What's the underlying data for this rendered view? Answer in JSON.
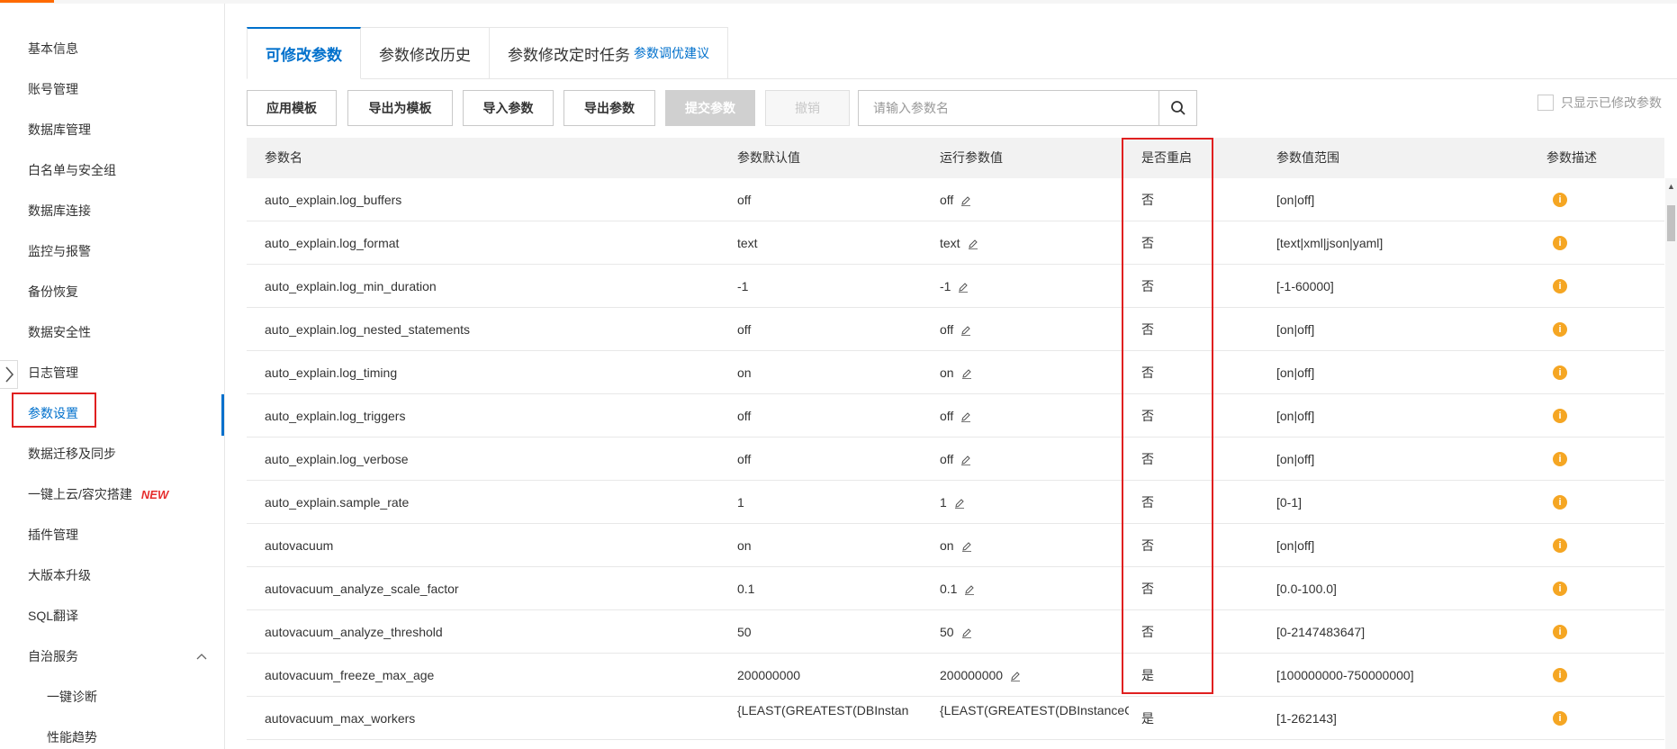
{
  "sidebar": {
    "items": [
      {
        "label": "基本信息"
      },
      {
        "label": "账号管理"
      },
      {
        "label": "数据库管理"
      },
      {
        "label": "白名单与安全组"
      },
      {
        "label": "数据库连接"
      },
      {
        "label": "监控与报警"
      },
      {
        "label": "备份恢复"
      },
      {
        "label": "数据安全性"
      },
      {
        "label": "日志管理"
      },
      {
        "label": "参数设置"
      },
      {
        "label": "数据迁移及同步"
      },
      {
        "label": "一键上云/容灾搭建"
      },
      {
        "label": "插件管理"
      },
      {
        "label": "大版本升级"
      },
      {
        "label": "SQL翻译"
      },
      {
        "label": "自治服务"
      },
      {
        "label": "一键诊断"
      },
      {
        "label": "性能趋势"
      }
    ],
    "new_badge": "NEW",
    "active": "参数设置"
  },
  "tabs": [
    {
      "label": "可修改参数"
    },
    {
      "label": "参数修改历史"
    },
    {
      "label": "参数修改定时任务"
    }
  ],
  "tab_link": "参数调优建议",
  "toolbar": {
    "apply_template": "应用模板",
    "export_as_template": "导出为模板",
    "import_params": "导入参数",
    "export_params": "导出参数",
    "submit_params": "提交参数",
    "revoke": "撤销"
  },
  "search": {
    "placeholder": "请输入参数名"
  },
  "only_modified_label": "只显示已修改参数",
  "table": {
    "headers": {
      "name": "参数名",
      "default": "参数默认值",
      "running": "运行参数值",
      "restart": "是否重启",
      "range": "参数值范围",
      "desc": "参数描述"
    },
    "rows": [
      {
        "name": "auto_explain.log_buffers",
        "default": "off",
        "running": "off",
        "restart": "否",
        "range": "[on|off]"
      },
      {
        "name": "auto_explain.log_format",
        "default": "text",
        "running": "text",
        "restart": "否",
        "range": "[text|xml|json|yaml]"
      },
      {
        "name": "auto_explain.log_min_duration",
        "default": "-1",
        "running": "-1",
        "restart": "否",
        "range": "[-1-60000]"
      },
      {
        "name": "auto_explain.log_nested_statements",
        "default": "off",
        "running": "off",
        "restart": "否",
        "range": "[on|off]"
      },
      {
        "name": "auto_explain.log_timing",
        "default": "on",
        "running": "on",
        "restart": "否",
        "range": "[on|off]"
      },
      {
        "name": "auto_explain.log_triggers",
        "default": "off",
        "running": "off",
        "restart": "否",
        "range": "[on|off]"
      },
      {
        "name": "auto_explain.log_verbose",
        "default": "off",
        "running": "off",
        "restart": "否",
        "range": "[on|off]"
      },
      {
        "name": "auto_explain.sample_rate",
        "default": "1",
        "running": "1",
        "restart": "否",
        "range": "[0-1]"
      },
      {
        "name": "autovacuum",
        "default": "on",
        "running": "on",
        "restart": "否",
        "range": "[on|off]"
      },
      {
        "name": "autovacuum_analyze_scale_factor",
        "default": "0.1",
        "running": "0.1",
        "restart": "否",
        "range": "[0.0-100.0]"
      },
      {
        "name": "autovacuum_analyze_threshold",
        "default": "50",
        "running": "50",
        "restart": "否",
        "range": "[0-2147483647]"
      },
      {
        "name": "autovacuum_freeze_max_age",
        "default": "200000000",
        "running": "200000000",
        "restart": "是",
        "range": "[100000000-750000000]"
      },
      {
        "name": "autovacuum_max_workers",
        "default": "{LEAST(GREATEST(DBInstan",
        "running": "{LEAST(GREATEST(DBInstanceC",
        "restart": "是",
        "range": "[1-262143]"
      }
    ]
  },
  "colors": {
    "accent": "#0070cc",
    "highlight_box": "#e02020",
    "info_icon": "#f5a623",
    "new_badge": "#e62e2e"
  }
}
